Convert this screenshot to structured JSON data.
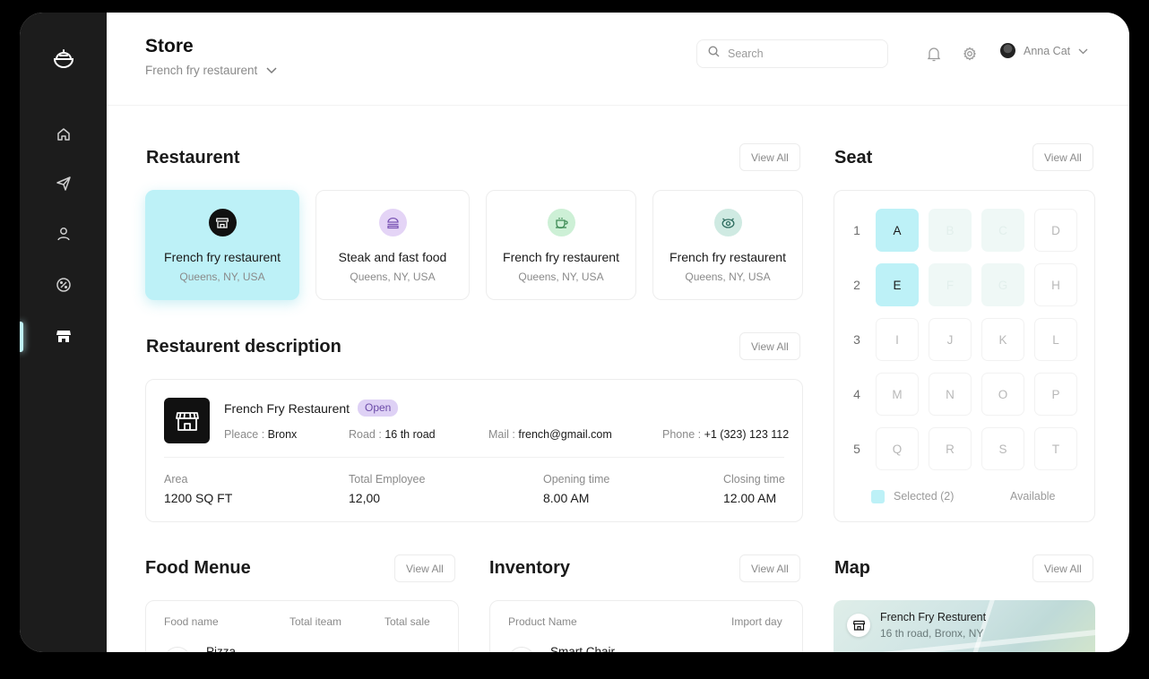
{
  "header": {
    "title": "Store",
    "store_selector": "French fry restaurent",
    "search_placeholder": "Search",
    "user_name": "Anna Cat"
  },
  "sidebar": {
    "items": [
      {
        "icon": "home-icon"
      },
      {
        "icon": "send-icon"
      },
      {
        "icon": "user-icon"
      },
      {
        "icon": "discount-icon"
      },
      {
        "icon": "store-icon",
        "active": true
      }
    ]
  },
  "restaurants": {
    "title": "Restaurent",
    "view_all": "View All",
    "items": [
      {
        "name": "French fry restaurent",
        "location": "Queens, NY, USA",
        "icon": "shop-icon",
        "icon_bg": "#111111",
        "active": true
      },
      {
        "name": "Steak and fast food",
        "location": "Queens, NY, USA",
        "icon": "burger-icon",
        "icon_bg": "#e4d4f6"
      },
      {
        "name": "French fry restaurent",
        "location": "Queens, NY, USA",
        "icon": "coffee-icon",
        "icon_bg": "#cdf0d6"
      },
      {
        "name": "French fry restaurent",
        "location": "Queens, NY, USA",
        "icon": "dish-icon",
        "icon_bg": "#cfeae2"
      }
    ]
  },
  "description": {
    "title": "Restaurent description",
    "view_all": "View All",
    "name": "French Fry Restaurent",
    "status": "Open",
    "place_label": "Pleace :",
    "place": "Bronx",
    "road_label": "Road :",
    "road": "16 th road",
    "mail_label": "Mail :",
    "mail": "french@gmail.com",
    "phone_label": "Phone :",
    "phone": "+1 (323) 123 112",
    "stats": [
      {
        "label": "Area",
        "value": "1200 SQ FT"
      },
      {
        "label": "Total Employee",
        "value": "12,00"
      },
      {
        "label": "Opening time",
        "value": "8.00 AM"
      },
      {
        "label": "Closing time",
        "value": "12.00 AM"
      }
    ]
  },
  "seat": {
    "title": "Seat",
    "view_all": "View All",
    "rows": [
      {
        "num": "1",
        "seats": [
          {
            "id": "A",
            "state": "selected"
          },
          {
            "id": "B",
            "state": "muted"
          },
          {
            "id": "C",
            "state": "muted"
          },
          {
            "id": "D",
            "state": "available"
          }
        ]
      },
      {
        "num": "2",
        "seats": [
          {
            "id": "E",
            "state": "selected"
          },
          {
            "id": "F",
            "state": "muted"
          },
          {
            "id": "G",
            "state": "muted"
          },
          {
            "id": "H",
            "state": "available"
          }
        ]
      },
      {
        "num": "3",
        "seats": [
          {
            "id": "I",
            "state": "available"
          },
          {
            "id": "J",
            "state": "available"
          },
          {
            "id": "K",
            "state": "available"
          },
          {
            "id": "L",
            "state": "available"
          }
        ]
      },
      {
        "num": "4",
        "seats": [
          {
            "id": "M",
            "state": "available"
          },
          {
            "id": "N",
            "state": "available"
          },
          {
            "id": "O",
            "state": "available"
          },
          {
            "id": "P",
            "state": "available"
          }
        ]
      },
      {
        "num": "5",
        "seats": [
          {
            "id": "Q",
            "state": "available"
          },
          {
            "id": "R",
            "state": "available"
          },
          {
            "id": "S",
            "state": "available"
          },
          {
            "id": "T",
            "state": "available"
          }
        ]
      }
    ],
    "legend_selected": "Selected (2)",
    "legend_available": "Available"
  },
  "food_menu": {
    "title": "Food Menue",
    "view_all": "View All",
    "columns": [
      "Food name",
      "Total iteam",
      "Total sale"
    ],
    "rows": [
      {
        "name": "Pizza"
      }
    ]
  },
  "inventory": {
    "title": "Inventory",
    "view_all": "View All",
    "columns": [
      "Product Name",
      "Import day"
    ],
    "rows": [
      {
        "name": "Smart Chair"
      }
    ]
  },
  "map": {
    "title": "Map",
    "view_all": "View All",
    "place_name": "French Fry Resturent",
    "place_address": "16 th road, Bronx, NY"
  },
  "colors": {
    "accent": "#bdf1f7",
    "sidebar_bg": "#1c1c1c",
    "badge_bg": "#ded1f5"
  }
}
